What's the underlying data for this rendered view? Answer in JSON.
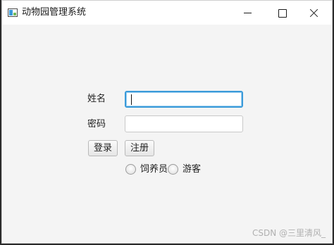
{
  "window": {
    "title": "动物园管理系统",
    "app_icon": "java-app-icon",
    "controls": {
      "minimize_icon": "minimize-icon",
      "maximize_icon": "maximize-icon",
      "close_icon": "close-icon"
    }
  },
  "form": {
    "name_label": "姓名",
    "name_value": "",
    "password_label": "密码",
    "password_value": "",
    "login_button": "登录",
    "register_button": "注册",
    "role_options": [
      {
        "label": "饲养员",
        "selected": false
      },
      {
        "label": "游客",
        "selected": false
      }
    ]
  },
  "watermark": "CSDN @三里清风_",
  "colors": {
    "focus_border": "#3a9ad9",
    "window_background": "#f4f4f4",
    "titlebar_background": "#ffffff"
  }
}
